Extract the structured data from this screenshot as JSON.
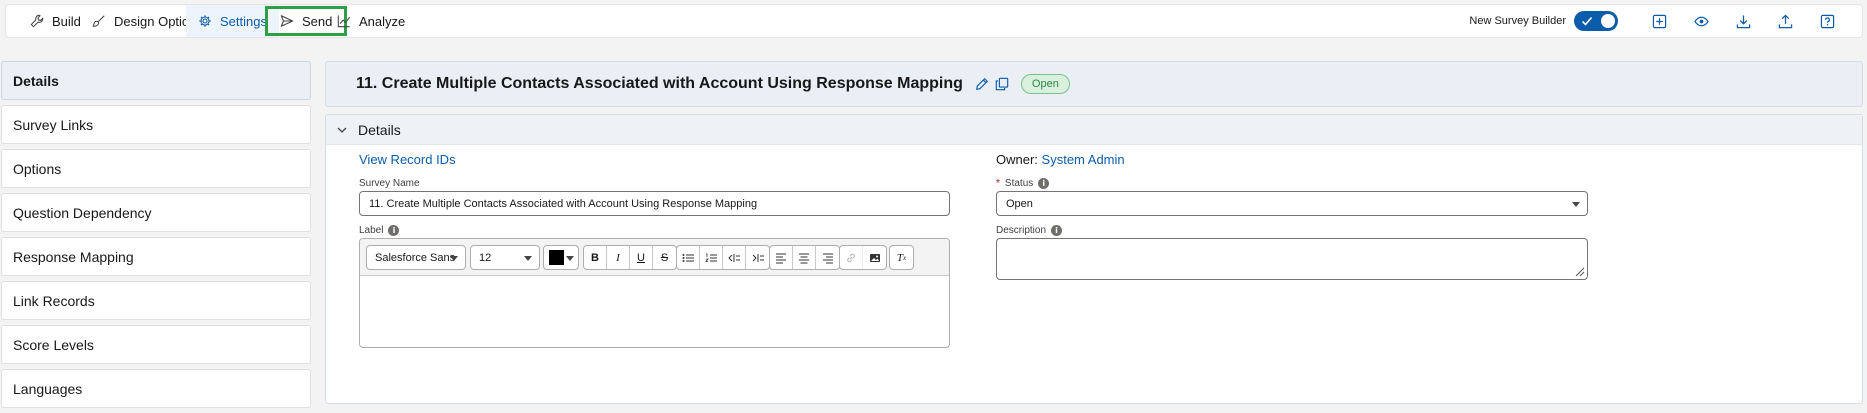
{
  "toolbar": {
    "tabs": [
      {
        "label": "Build",
        "icon": "wrench-icon"
      },
      {
        "label": "Design Options",
        "icon": "brush-icon"
      },
      {
        "label": "Settings",
        "icon": "gear-icon"
      },
      {
        "label": "Send",
        "icon": "send-icon"
      },
      {
        "label": "Analyze",
        "icon": "chart-icon"
      }
    ],
    "active_tab": "Settings",
    "highlighted_tab": "Send",
    "new_builder_label": "New Survey Builder",
    "new_builder_enabled": true
  },
  "sidebar": {
    "items": [
      {
        "label": "Details",
        "active": true
      },
      {
        "label": "Survey Links"
      },
      {
        "label": "Options"
      },
      {
        "label": "Question Dependency"
      },
      {
        "label": "Response Mapping"
      },
      {
        "label": "Link Records"
      },
      {
        "label": "Score Levels"
      },
      {
        "label": "Languages"
      }
    ]
  },
  "header": {
    "title": "11. Create Multiple Contacts Associated with Account Using Response Mapping",
    "status_badge": "Open"
  },
  "details": {
    "section_title": "Details",
    "view_record_ids": "View Record IDs",
    "owner_label": "Owner:",
    "owner_value": "System Admin",
    "survey_name_label": "Survey Name",
    "survey_name_value": "11. Create Multiple Contacts Associated with Account Using Response Mapping",
    "status_label": "Status",
    "status_value": "Open",
    "label_label": "Label",
    "description_label": "Description",
    "description_value": "",
    "editor": {
      "font_family": "Salesforce Sans",
      "font_size": "12",
      "text_color": "#000000"
    }
  },
  "colors": {
    "accent": "#0b5cab",
    "highlight": "#2e9e48",
    "badge_bg": "#d9f1dc"
  }
}
